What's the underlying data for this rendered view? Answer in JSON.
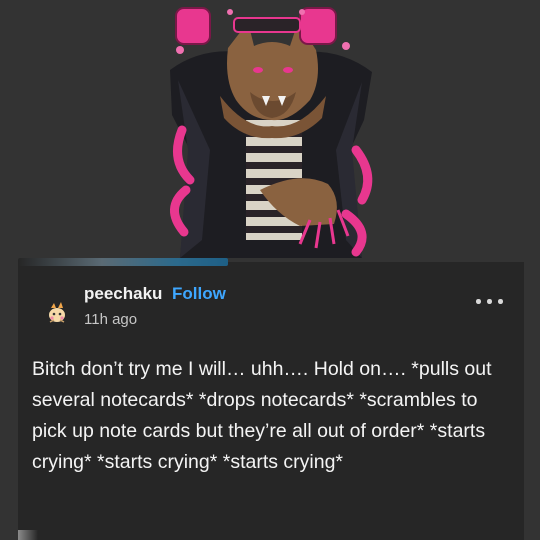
{
  "post": {
    "username": "peechaku",
    "follow_label": "Follow",
    "timestamp": "11h ago",
    "body": "Bitch don’t try me I will… uhh…. Hold on…. *pulls out several notecards* *drops notecards* *scrambles to pick up note cards but they’re all out of order* *starts crying* *starts crying* *starts crying*"
  },
  "icons": {
    "avatar": "avatar-icon",
    "more": "more-options-icon",
    "artwork": "werewolf-artwork"
  },
  "colors": {
    "background": "#333333",
    "card": "#262626",
    "follow_accent": "#3ea7ff",
    "artwork_accent": "#e8378f"
  }
}
